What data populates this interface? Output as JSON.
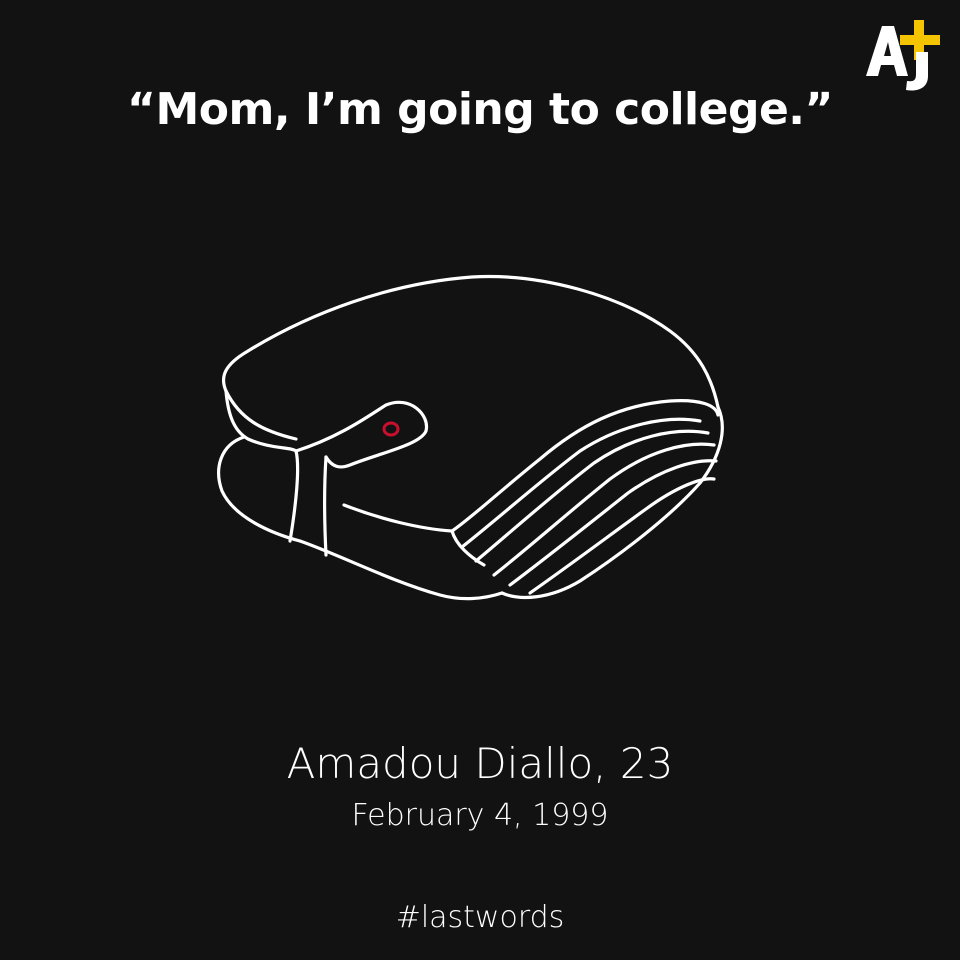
{
  "brand": {
    "logo_text": "AJ+",
    "accent_color": "#f5c400",
    "logo_icon": "aj-plus-logo-icon"
  },
  "quote": {
    "text": "“Mom, I’m going to college.”"
  },
  "illustration": {
    "icon": "wallet-icon",
    "stroke_color": "#ffffff",
    "clasp_color": "#c8102e"
  },
  "person": {
    "name": "Amadou Diallo, 23",
    "date": "February 4, 1999"
  },
  "footer": {
    "hashtag": "#lastwords"
  },
  "background_color": "#121212"
}
